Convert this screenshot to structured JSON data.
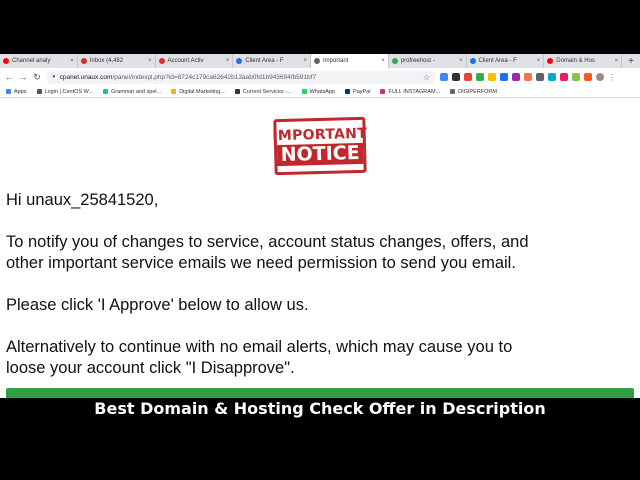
{
  "browser": {
    "tabs": [
      {
        "label": "Channel analy",
        "color": "#ff0000",
        "active": false
      },
      {
        "label": "Inbox (4,482",
        "color": "#d93025",
        "active": false
      },
      {
        "label": "Account Activ",
        "color": "#d93025",
        "active": false
      },
      {
        "label": "Client Area - F",
        "color": "#1a73e8",
        "active": false
      },
      {
        "label": "Important",
        "color": "#5f6368",
        "active": true
      },
      {
        "label": "profreehost -",
        "color": "#34a853",
        "active": false
      },
      {
        "label": "Client Area - F",
        "color": "#1a73e8",
        "active": false
      },
      {
        "label": "Domain & Hos",
        "color": "#ff0000",
        "active": false
      }
    ],
    "new_tab": "+",
    "url_host": "cpanel.unaux.com",
    "url_path": "/panel/indexpl.php?id=8724c179ca62642b13aab0fd1b943694fb591bf7",
    "bookmarks": [
      {
        "label": "Apps",
        "color": "#4285f4"
      },
      {
        "label": "Login | CentOS W...",
        "color": "#555555"
      },
      {
        "label": "Grammar and spel...",
        "color": "#15c39a"
      },
      {
        "label": "Digital Marketing...",
        "color": "#f4b400"
      },
      {
        "label": "Current Services -...",
        "color": "#333333"
      },
      {
        "label": "WhatsApp",
        "color": "#25d366"
      },
      {
        "label": "PayPal",
        "color": "#003087"
      },
      {
        "label": "FULL INSTAGRAM...",
        "color": "#c13584"
      },
      {
        "label": "DIGIPERFORM",
        "color": "#666666"
      }
    ]
  },
  "notice": {
    "stamp_line1": "IMPORTANT",
    "stamp_line2": "NOTICE",
    "greeting": "Hi unaux_25841520,",
    "paragraph1_line1": "To notify you of changes to service, account status changes, offers, and",
    "paragraph1_line2": "other important service emails we need permission to send you email.",
    "paragraph2": "Please click 'I Approve' below to allow us.",
    "paragraph3_line1": "Alternatively to continue with no email alerts, which may cause you to",
    "paragraph3_line2": "loose your account click \"I Disapprove\"."
  },
  "caption": "Best Domain & Hosting Check Offer in Description",
  "colors": {
    "stamp_red": "#c0282d",
    "approve_green": "#2f9e44"
  }
}
